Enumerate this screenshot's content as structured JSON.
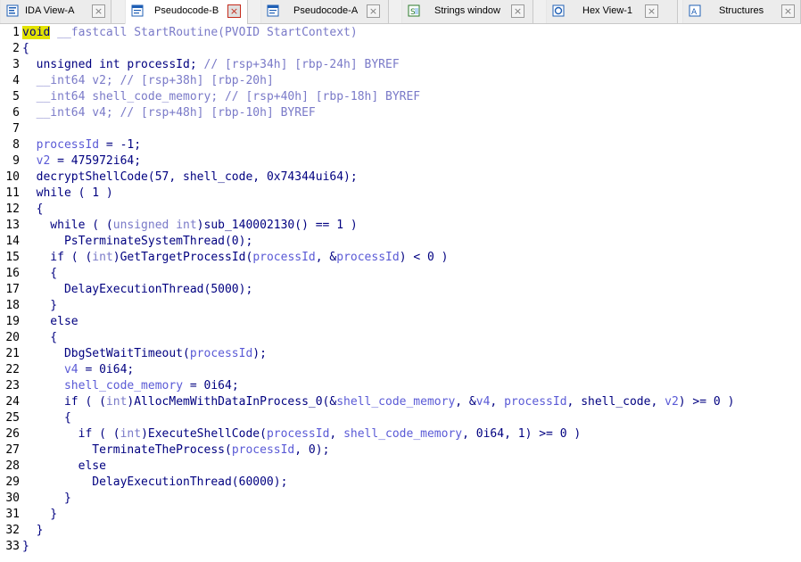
{
  "tabs": [
    {
      "label": "IDA View-A",
      "icon": "disassembly-icon",
      "active": false
    },
    {
      "label": "Pseudocode-B",
      "icon": "pseudocode-icon",
      "active": true
    },
    {
      "label": "Pseudocode-A",
      "icon": "pseudocode-icon",
      "active": false
    },
    {
      "label": "Strings window",
      "icon": "strings-icon",
      "active": false
    },
    {
      "label": "Hex View-1",
      "icon": "hex-view-icon",
      "active": false
    },
    {
      "label": "Structures",
      "icon": "structures-icon",
      "active": false
    }
  ],
  "close_glyph": "×",
  "code_lines": [
    {
      "n": "1",
      "tokens": [
        [
          "void",
          "hl"
        ],
        [
          " __fastcall StartRoutine(PVOID StartContext)",
          "cmt"
        ]
      ]
    },
    {
      "n": "2",
      "tokens": [
        [
          "{",
          "op"
        ]
      ]
    },
    {
      "n": "3",
      "tokens": [
        [
          "  unsigned int processId; ",
          "kw"
        ],
        [
          "// [rsp+34h] [rbp-24h] BYREF",
          "cmt"
        ]
      ]
    },
    {
      "n": "4",
      "tokens": [
        [
          "  __int64 v2; ",
          "cmt"
        ],
        [
          "// [rsp+38h] [rbp-20h]",
          "cmt"
        ]
      ]
    },
    {
      "n": "5",
      "tokens": [
        [
          "  __int64 shell_code_memory; ",
          "cmt"
        ],
        [
          "// [rsp+40h] [rbp-18h] BYREF",
          "cmt"
        ]
      ]
    },
    {
      "n": "6",
      "tokens": [
        [
          "  __int64 v4; ",
          "cmt"
        ],
        [
          "// [rsp+48h] [rbp-10h] BYREF",
          "cmt"
        ]
      ]
    },
    {
      "n": "7",
      "tokens": []
    },
    {
      "n": "8",
      "tokens": [
        [
          "  ",
          "op"
        ],
        [
          "processId",
          "var"
        ],
        [
          " = -1;",
          "op"
        ]
      ]
    },
    {
      "n": "9",
      "tokens": [
        [
          "  ",
          "op"
        ],
        [
          "v2",
          "var"
        ],
        [
          " = 475972i64;",
          "op"
        ]
      ]
    },
    {
      "n": "10",
      "tokens": [
        [
          "  decryptShellCode(57, ",
          "fn"
        ],
        [
          "shell_code",
          "kw"
        ],
        [
          ", 0x74344ui64);",
          "op"
        ]
      ]
    },
    {
      "n": "11",
      "tokens": [
        [
          "  while ( 1 )",
          "kw"
        ]
      ]
    },
    {
      "n": "12",
      "tokens": [
        [
          "  {",
          "op"
        ]
      ]
    },
    {
      "n": "13",
      "tokens": [
        [
          "    while ( (",
          "kw"
        ],
        [
          "unsigned int",
          "cmt"
        ],
        [
          ")sub_140002130() == 1 )",
          "fn"
        ]
      ]
    },
    {
      "n": "14",
      "tokens": [
        [
          "      PsTerminateSystemThread(0);",
          "fn"
        ]
      ]
    },
    {
      "n": "15",
      "tokens": [
        [
          "    if ( (",
          "kw"
        ],
        [
          "int",
          "cmt"
        ],
        [
          ")GetTargetProcessId(",
          "fn"
        ],
        [
          "processId",
          "var"
        ],
        [
          ", &",
          "op"
        ],
        [
          "processId",
          "var"
        ],
        [
          ") < 0 )",
          "op"
        ]
      ]
    },
    {
      "n": "16",
      "tokens": [
        [
          "    {",
          "op"
        ]
      ]
    },
    {
      "n": "17",
      "tokens": [
        [
          "      DelayExecutionThread(5000);",
          "fn"
        ]
      ]
    },
    {
      "n": "18",
      "tokens": [
        [
          "    }",
          "op"
        ]
      ]
    },
    {
      "n": "19",
      "tokens": [
        [
          "    else",
          "kw"
        ]
      ]
    },
    {
      "n": "20",
      "tokens": [
        [
          "    {",
          "op"
        ]
      ]
    },
    {
      "n": "21",
      "tokens": [
        [
          "      DbgSetWaitTimeout(",
          "fn"
        ],
        [
          "processId",
          "var"
        ],
        [
          ");",
          "op"
        ]
      ]
    },
    {
      "n": "22",
      "tokens": [
        [
          "      ",
          "op"
        ],
        [
          "v4",
          "var"
        ],
        [
          " = 0i64;",
          "op"
        ]
      ]
    },
    {
      "n": "23",
      "tokens": [
        [
          "      ",
          "op"
        ],
        [
          "shell_code_memory",
          "var"
        ],
        [
          " = 0i64;",
          "op"
        ]
      ]
    },
    {
      "n": "24",
      "tokens": [
        [
          "      if ( (",
          "kw"
        ],
        [
          "int",
          "cmt"
        ],
        [
          ")AllocMemWithDataInProcess_0(&",
          "fn"
        ],
        [
          "shell_code_memory",
          "var"
        ],
        [
          ", &",
          "op"
        ],
        [
          "v4",
          "var"
        ],
        [
          ", ",
          "op"
        ],
        [
          "processId",
          "var"
        ],
        [
          ", ",
          "op"
        ],
        [
          "shell_code",
          "kw"
        ],
        [
          ", ",
          "op"
        ],
        [
          "v2",
          "var"
        ],
        [
          ") >= 0 )",
          "op"
        ]
      ]
    },
    {
      "n": "25",
      "tokens": [
        [
          "      {",
          "op"
        ]
      ]
    },
    {
      "n": "26",
      "tokens": [
        [
          "        if ( (",
          "kw"
        ],
        [
          "int",
          "cmt"
        ],
        [
          ")ExecuteShellCode(",
          "fn"
        ],
        [
          "processId",
          "var"
        ],
        [
          ", ",
          "op"
        ],
        [
          "shell_code_memory",
          "var"
        ],
        [
          ", 0i64, 1) >= 0 )",
          "op"
        ]
      ]
    },
    {
      "n": "27",
      "tokens": [
        [
          "          TerminateTheProcess(",
          "fn"
        ],
        [
          "processId",
          "var"
        ],
        [
          ", 0);",
          "op"
        ]
      ]
    },
    {
      "n": "28",
      "tokens": [
        [
          "        else",
          "kw"
        ]
      ]
    },
    {
      "n": "29",
      "tokens": [
        [
          "          DelayExecutionThread(60000);",
          "fn"
        ]
      ]
    },
    {
      "n": "30",
      "tokens": [
        [
          "      }",
          "op"
        ]
      ]
    },
    {
      "n": "31",
      "tokens": [
        [
          "    }",
          "op"
        ]
      ]
    },
    {
      "n": "32",
      "tokens": [
        [
          "  }",
          "op"
        ]
      ]
    },
    {
      "n": "33",
      "tokens": [
        [
          "}",
          "op"
        ]
      ]
    }
  ],
  "colors": {
    "keyword": "#000080",
    "variable": "#5a5ad6",
    "comment": "#7a7ac8",
    "highlight": "#e3e300",
    "active_tab_close": "#c42b1c"
  }
}
